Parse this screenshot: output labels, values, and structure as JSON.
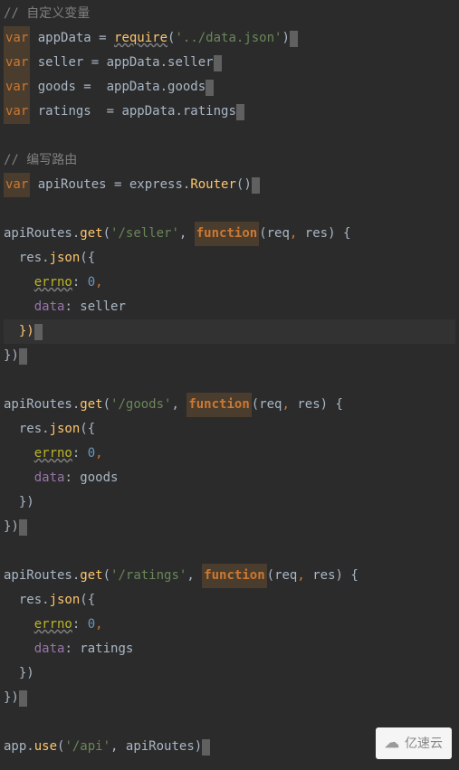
{
  "lines": [
    {
      "type": "comment",
      "text": "// 自定义变量"
    },
    {
      "type": "var-require",
      "kw": "var",
      "name": " appData = ",
      "func": "require",
      "open": "(",
      "str": "'../data.json'",
      "close": ")",
      "cursor": true
    },
    {
      "type": "var-assign",
      "kw": "var",
      "text": " seller = appData.",
      "prop": "seller",
      "cursor": true
    },
    {
      "type": "var-assign",
      "kw": "var",
      "text": " goods =  appData.",
      "prop": "goods",
      "cursor": true
    },
    {
      "type": "var-assign",
      "kw": "var",
      "text": " ratings  = appData.",
      "prop": "ratings",
      "cursor": true
    },
    {
      "type": "empty"
    },
    {
      "type": "comment",
      "text": "// 编写路由"
    },
    {
      "type": "var-express",
      "kw": "var",
      "text": " apiRoutes = ",
      "obj": "express",
      "dot": ".",
      "method": "Router",
      "parens": "()",
      "cursor": true
    },
    {
      "type": "empty"
    },
    {
      "type": "route-start",
      "obj": "apiRoutes.",
      "method": "get",
      "open": "(",
      "str": "'/seller'",
      "comma": ", ",
      "func": "function",
      "args": "(req, res)",
      "brace": " {"
    },
    {
      "type": "res-json",
      "indent": "  ",
      "obj": "res.",
      "method": "json",
      "paren": "({"
    },
    {
      "type": "prop-line",
      "indent": "    ",
      "key": "errno",
      "colon": ": ",
      "val": "0",
      "comma": ","
    },
    {
      "type": "prop-line2",
      "indent": "    ",
      "key": "data",
      "colon": ": ",
      "val": "seller"
    },
    {
      "type": "close1",
      "indent": "  ",
      "text": "})",
      "highlighted": true,
      "cursor": true
    },
    {
      "type": "close2",
      "text": "})",
      "cursor": true
    },
    {
      "type": "empty"
    },
    {
      "type": "route-start",
      "obj": "apiRoutes.",
      "method": "get",
      "open": "(",
      "str": "'/goods'",
      "comma": ", ",
      "func": "function",
      "args": "(req, res)",
      "brace": " {"
    },
    {
      "type": "res-json",
      "indent": "  ",
      "obj": "res.",
      "method": "json",
      "paren": "({"
    },
    {
      "type": "prop-line",
      "indent": "    ",
      "key": "errno",
      "colon": ": ",
      "val": "0",
      "comma": ","
    },
    {
      "type": "prop-line2",
      "indent": "    ",
      "key": "data",
      "colon": ": ",
      "val": "goods"
    },
    {
      "type": "close1",
      "indent": "  ",
      "text": "})"
    },
    {
      "type": "close2",
      "text": "})",
      "cursor": true
    },
    {
      "type": "empty"
    },
    {
      "type": "route-start",
      "obj": "apiRoutes.",
      "method": "get",
      "open": "(",
      "str": "'/ratings'",
      "comma": ", ",
      "func": "function",
      "args": "(req, res)",
      "brace": " {"
    },
    {
      "type": "res-json",
      "indent": "  ",
      "obj": "res.",
      "method": "json",
      "paren": "({"
    },
    {
      "type": "prop-line",
      "indent": "    ",
      "key": "errno",
      "colon": ": ",
      "val": "0",
      "comma": ","
    },
    {
      "type": "prop-line2",
      "indent": "    ",
      "key": "data",
      "colon": ": ",
      "val": "ratings"
    },
    {
      "type": "close1",
      "indent": "  ",
      "text": "})"
    },
    {
      "type": "close2",
      "text": "})",
      "cursor": true
    },
    {
      "type": "empty"
    },
    {
      "type": "app-use",
      "obj": "app.",
      "method": "use",
      "open": "(",
      "str": "'/api'",
      "comma": ", ",
      "arg": "apiRoutes",
      "close": ")",
      "cursor": true
    }
  ],
  "watermark": {
    "icon": "☁",
    "text": "亿速云"
  }
}
